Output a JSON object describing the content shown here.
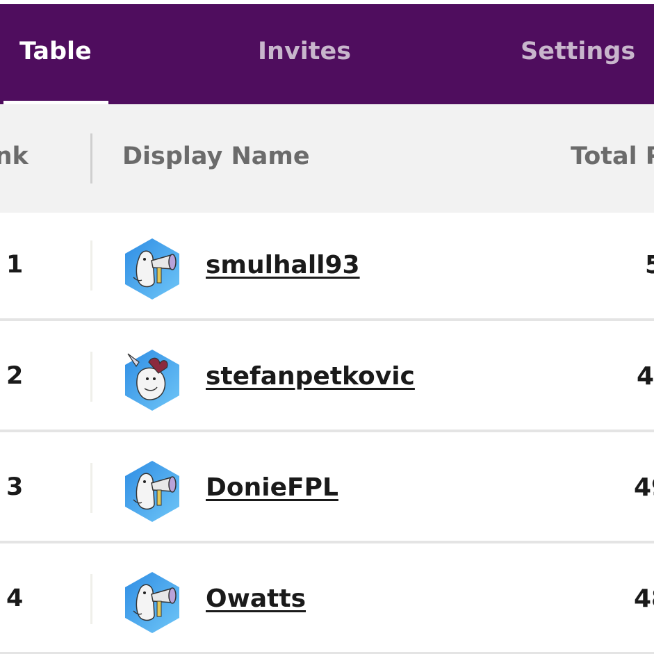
{
  "tabs": {
    "table_label": "Table",
    "invites_label": "Invites",
    "settings_label": "Settings"
  },
  "table": {
    "headers": {
      "rank": "Rank",
      "display_name": "Display Name",
      "total": "Total Points"
    },
    "rows": [
      {
        "rank": "1",
        "name": "smulhall93",
        "total": "5"
      },
      {
        "rank": "2",
        "name": "stefanpetkovic",
        "total": "4"
      },
      {
        "rank": "3",
        "name": "DonieFPL",
        "total": "49"
      },
      {
        "rank": "4",
        "name": "Owatts",
        "total": "48"
      }
    ]
  },
  "colors": {
    "tabbar_background": "#4f0d5e",
    "active_tab_text": "#ffffff",
    "inactive_tab_text": "#c8b6cc",
    "header_background": "#f2f2f2",
    "avatar_gradient_start": "#2f8de4",
    "avatar_gradient_end": "#6fc6f7"
  },
  "icons": {
    "avatar": "hexagon-mascot-avatar-icon"
  }
}
